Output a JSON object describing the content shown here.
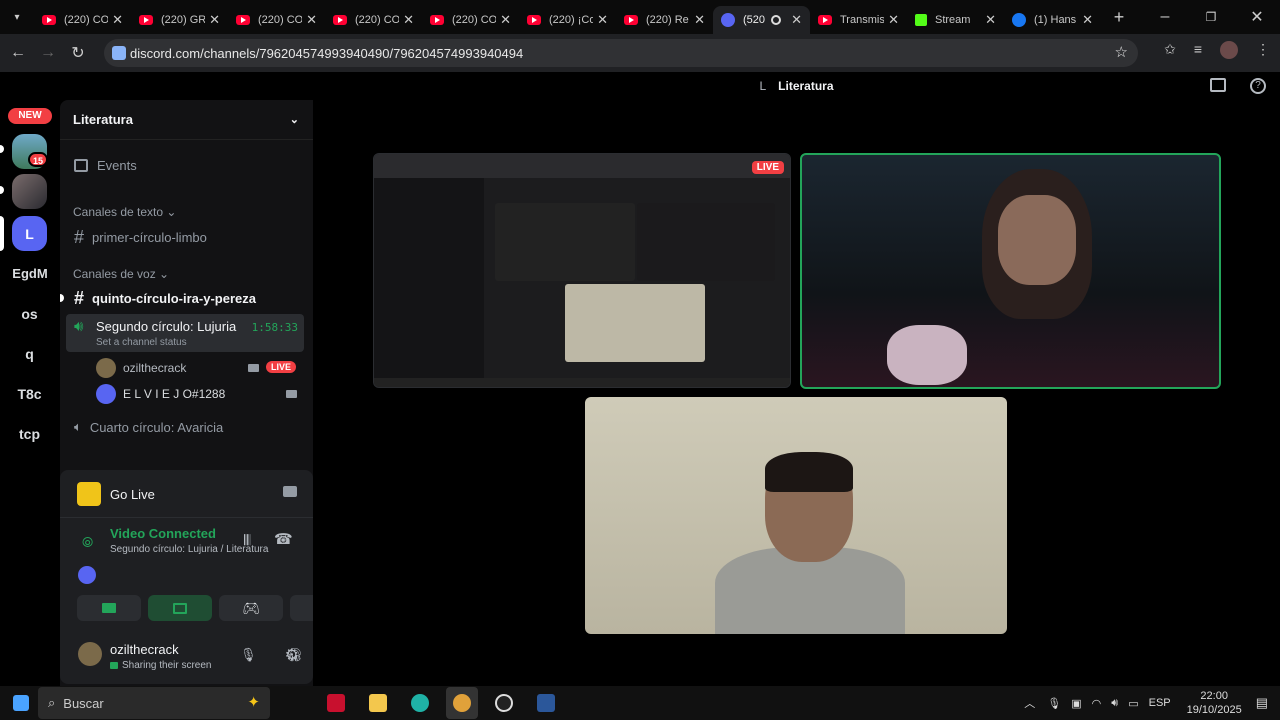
{
  "browser": {
    "tabs": [
      {
        "title": "(220) CO",
        "icon": "youtube",
        "active": false
      },
      {
        "title": "(220) GR",
        "icon": "youtube",
        "active": false
      },
      {
        "title": "(220) CO",
        "icon": "youtube",
        "active": false
      },
      {
        "title": "(220) CO",
        "icon": "youtube",
        "active": false
      },
      {
        "title": "(220) CO",
        "icon": "youtube",
        "active": false
      },
      {
        "title": "(220) ¡Co",
        "icon": "youtube",
        "active": false
      },
      {
        "title": "(220) Re",
        "icon": "youtube",
        "active": false
      },
      {
        "title": "(520",
        "icon": "discord",
        "active": true,
        "badge": "520"
      },
      {
        "title": "Transmis",
        "icon": "youtube",
        "active": false
      },
      {
        "title": "Stream",
        "icon": "kick",
        "active": false
      },
      {
        "title": "(1) Hans",
        "icon": "facebook",
        "active": false
      }
    ],
    "url": "discord.com/channels/796204574993940490/796204574993940494"
  },
  "discord": {
    "header_title": "Literatura",
    "header_prefix": "L",
    "servers": [
      {
        "label": "NEW",
        "type": "badge"
      },
      {
        "label": "",
        "badge": "15"
      },
      {
        "label": ""
      },
      {
        "label": "L"
      },
      {
        "label": "EgdM"
      },
      {
        "label": "os"
      },
      {
        "label": "q"
      },
      {
        "label": "T8c"
      },
      {
        "label": "tcp"
      }
    ],
    "server_name": "Literatura",
    "events_label": "Events",
    "text_category": "Canales de texto",
    "text_channel": "primer-círculo-limbo",
    "voice_category": "Canales de voz",
    "voice_channel_1": "quinto-círculo-ira-y-pereza",
    "voice_channel_2": "Segundo círculo: Lujuria",
    "voice_channel_2_timer": "1:58:33",
    "voice_channel_2_status": "Set a channel status",
    "voice_users": [
      {
        "name": "ozilthecrack",
        "live": "LIVE"
      },
      {
        "name": "E L V I E J O#1288"
      }
    ],
    "voice_channel_3": "Cuarto círculo: Avaricia",
    "go_live": "Go Live",
    "video_connected": "Video Connected",
    "connected_to": "Segundo círculo: Lujuria / Literatura",
    "user_name": "ozilthecrack",
    "user_status": "Sharing their screen",
    "live_badge": "LIVE"
  },
  "taskbar": {
    "search_placeholder": "Buscar",
    "lang": "ESP",
    "time": "22:00",
    "date": "19/10/2025"
  },
  "colors": {
    "accent_green": "#23a55a",
    "live_red": "#f23f43",
    "blurple": "#5865f2"
  }
}
